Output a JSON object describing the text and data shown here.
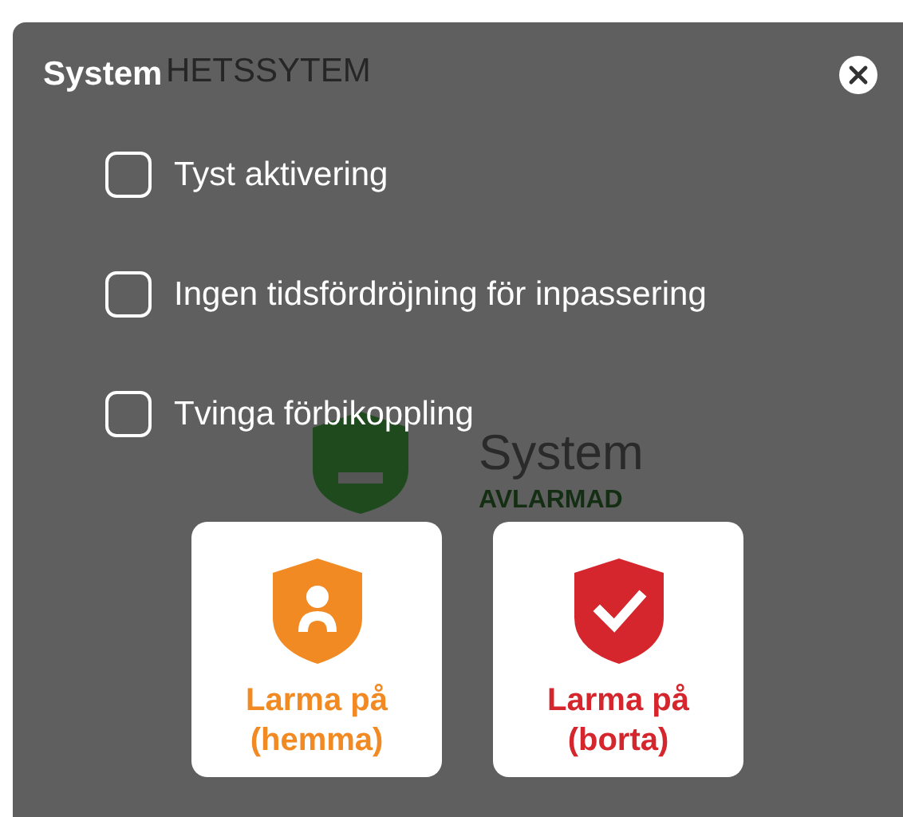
{
  "background": {
    "header": "HETSSYTEM",
    "device_name": "System",
    "status": "AVLARMAD"
  },
  "dialog": {
    "title": "System",
    "options": [
      {
        "label": "Tyst aktivering",
        "checked": false
      },
      {
        "label": "Ingen tidsfördröjning för inpassering",
        "checked": false
      },
      {
        "label": "Tvinga förbikoppling",
        "checked": false
      }
    ],
    "actions": [
      {
        "label": "Larma på (hemma)",
        "kind": "home",
        "color": "#f28a24"
      },
      {
        "label": "Larma på (borta)",
        "kind": "away",
        "color": "#d4262c"
      }
    ]
  }
}
